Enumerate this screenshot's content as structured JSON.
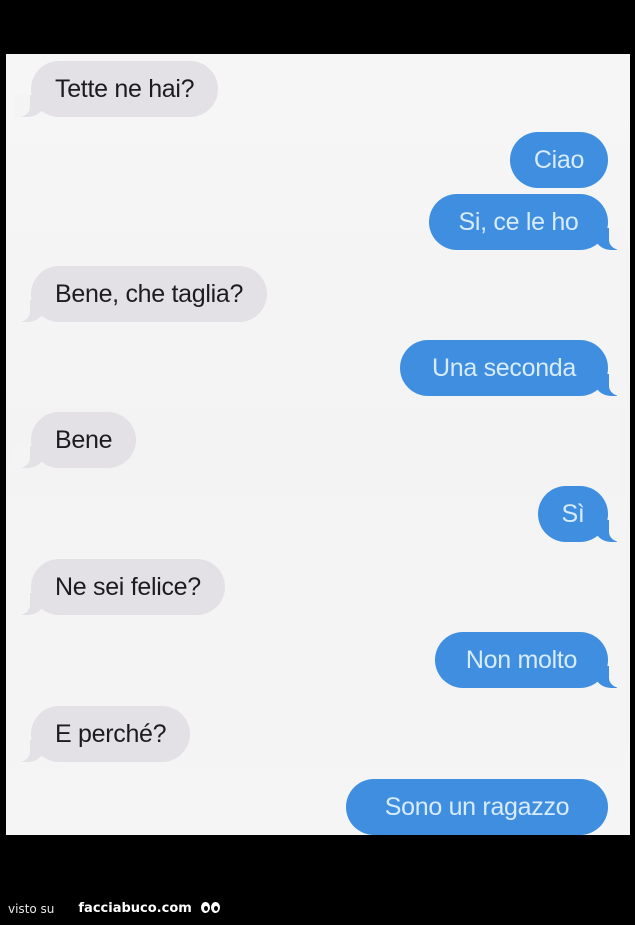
{
  "conversation": {
    "messages": [
      {
        "sender": "incoming",
        "text": "Tette ne hai?"
      },
      {
        "sender": "outgoing",
        "text": "Ciao"
      },
      {
        "sender": "outgoing",
        "text": "Si, ce le ho"
      },
      {
        "sender": "incoming",
        "text": "Bene, che taglia?"
      },
      {
        "sender": "outgoing",
        "text": "Una seconda"
      },
      {
        "sender": "incoming",
        "text": "Bene"
      },
      {
        "sender": "outgoing",
        "text": "Sì"
      },
      {
        "sender": "incoming",
        "text": "Ne sei felice?"
      },
      {
        "sender": "outgoing",
        "text": "Non molto"
      },
      {
        "sender": "incoming",
        "text": "E perché?"
      },
      {
        "sender": "outgoing",
        "text": "Sono un ragazzo"
      }
    ]
  },
  "colors": {
    "incoming_bubble": "#e3e1e6",
    "outgoing_bubble": "#3f8ee0",
    "outgoing_text": "#d8ecff",
    "background": "#f4f4f4"
  },
  "watermark": {
    "prefix": "visto su",
    "site": "facciabuco.com",
    "icon": "eyes-icon"
  }
}
